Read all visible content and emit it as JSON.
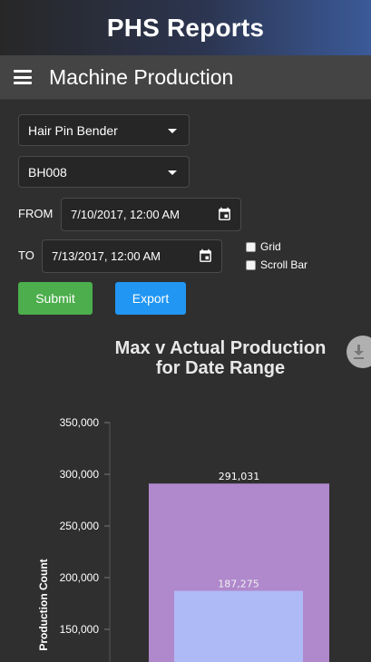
{
  "app": {
    "title": "PHS Reports"
  },
  "toolbar": {
    "title": "Machine Production"
  },
  "filters": {
    "machine_type": "Hair Pin Bender",
    "machine_id": "BH008",
    "from_label": "FROM",
    "from_value": "7/10/2017, 12:00 AM",
    "to_label": "TO",
    "to_value": "7/13/2017, 12:00 AM",
    "grid_label": "Grid",
    "scrollbar_label": "Scroll Bar"
  },
  "buttons": {
    "submit": "Submit",
    "export": "Export"
  },
  "chart_data": {
    "type": "bar",
    "title": "Max v Actual Production for Date Range",
    "ylabel": "Production Count",
    "xlabel": "",
    "ylim": [
      0,
      350000
    ],
    "yticks": [
      "350,000",
      "300,000",
      "250,000",
      "200,000",
      "150,000"
    ],
    "ytick_values": [
      350000,
      300000,
      250000,
      200000,
      150000
    ],
    "series": [
      {
        "values": [
          291031
        ],
        "labels": [
          "291,031"
        ],
        "color": "#b088cc"
      },
      {
        "values": [
          187275
        ],
        "labels": [
          "187,275"
        ],
        "color": "#aebaf5"
      }
    ]
  }
}
